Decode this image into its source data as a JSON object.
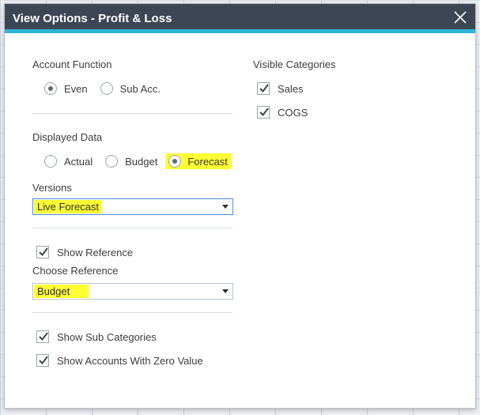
{
  "dialog": {
    "title": "View Options - Profit & Loss"
  },
  "account_function": {
    "label": "Account Function",
    "options": [
      {
        "label": "Even",
        "checked": true
      },
      {
        "label": "Sub Acc.",
        "checked": false
      }
    ]
  },
  "displayed_data": {
    "label": "Displayed Data",
    "options": [
      {
        "label": "Actual",
        "checked": false
      },
      {
        "label": "Budget",
        "checked": false
      },
      {
        "label": "Forecast",
        "checked": true
      }
    ]
  },
  "versions": {
    "label": "Versions",
    "value": "Live Forecast"
  },
  "reference": {
    "show_label": "Show Reference",
    "show_checked": true,
    "choose_label": "Choose Reference",
    "value": "Budget"
  },
  "options": {
    "show_sub_categories": "Show Sub Categories",
    "show_zero_value": "Show Accounts With Zero Value"
  },
  "visible_categories": {
    "label": "Visible Categories",
    "items": [
      {
        "label": "Sales",
        "checked": true
      },
      {
        "label": "COGS",
        "checked": true
      }
    ]
  },
  "colors": {
    "titlebar": "#3d4654",
    "accent": "#2fb3d6",
    "highlight": "#ffff33"
  },
  "icons": {
    "close": "close-icon",
    "check": "checkmark-icon",
    "dropdown": "chevron-down-icon"
  }
}
